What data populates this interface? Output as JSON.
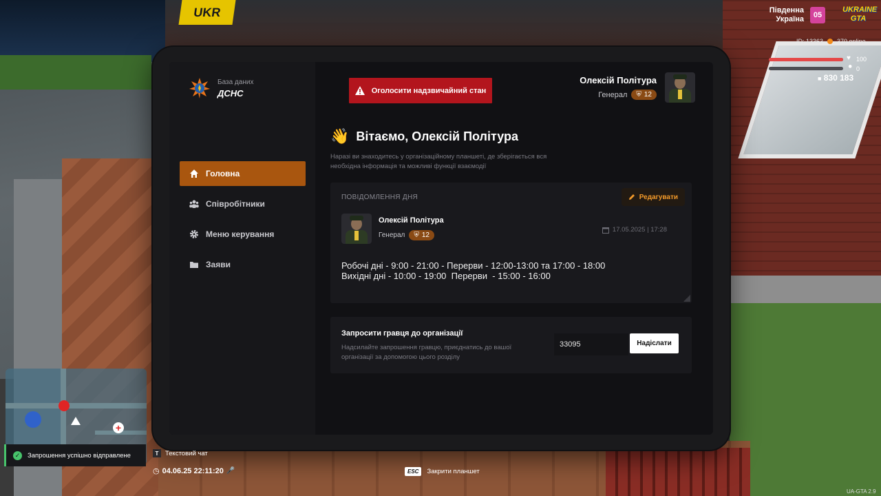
{
  "sidebar": {
    "logo_sub": "База даних",
    "logo_main": "ДСНС",
    "items": [
      {
        "label": "Головна",
        "icon": "home-icon",
        "active": true
      },
      {
        "label": "Співробітники",
        "icon": "users-icon",
        "active": false
      },
      {
        "label": "Меню керування",
        "icon": "gear-icon",
        "active": false
      },
      {
        "label": "Заяви",
        "icon": "folder-icon",
        "active": false
      }
    ]
  },
  "header": {
    "emergency_label": "Оголосити надзвичайний стан",
    "user_name": "Олексій Політура",
    "user_role": "Генерал",
    "user_level": "12"
  },
  "welcome": {
    "title": "Вітаємо, Олексій Політура",
    "text": "Наразі ви знаходитесь у організаційному планшеті, де зберігається вся необхідна інформація та можливі функції взаємодії"
  },
  "motd": {
    "title": "ПОВІДОМЛЕННЯ ДНЯ",
    "edit_label": "Редагувати",
    "author_name": "Олексій Політура",
    "author_role": "Генерал",
    "author_level": "12",
    "date": "17.05.2025 | 17:28",
    "line1": "Робочі дні - 9:00 - 21:00 - Перерви - 12:00-13:00 та 17:00 - 18:00",
    "line2": "Вихідні дні - 10:00 - 19:00  Перерви  - 15:00 - 16:00"
  },
  "invite": {
    "title": "Запросити гравця до організації",
    "desc": "Надсилайте запрошення гравцю, приєднатись до вашої організації за допомогою цього розділу",
    "input_value": "33095",
    "button_label": "Надіслати"
  },
  "hud": {
    "region_line1": "Південна",
    "region_line2": "Україна",
    "server_number": "05",
    "logo_line1": "UKRAINE",
    "logo_line2": "GTA",
    "player_id": "ID: 13363",
    "online": "370 online",
    "health": "100",
    "armor": "0",
    "money": "830 183",
    "health_fraction": 1.0,
    "armor_fraction": 0.0
  },
  "toast": {
    "text": "Запрошення успішно відправлене"
  },
  "chat_hint": {
    "key": "T",
    "label": "Текстовий чат"
  },
  "datetime": "04.06.25 22:11:20",
  "esc_hint": {
    "key": "ESC",
    "label": "Закрити планшет"
  },
  "version": "UA-GTA 2.9",
  "colors": {
    "accent": "#a9560f",
    "emergency": "#b3151d",
    "edit": "#f39a2a",
    "success": "#47c36b"
  }
}
